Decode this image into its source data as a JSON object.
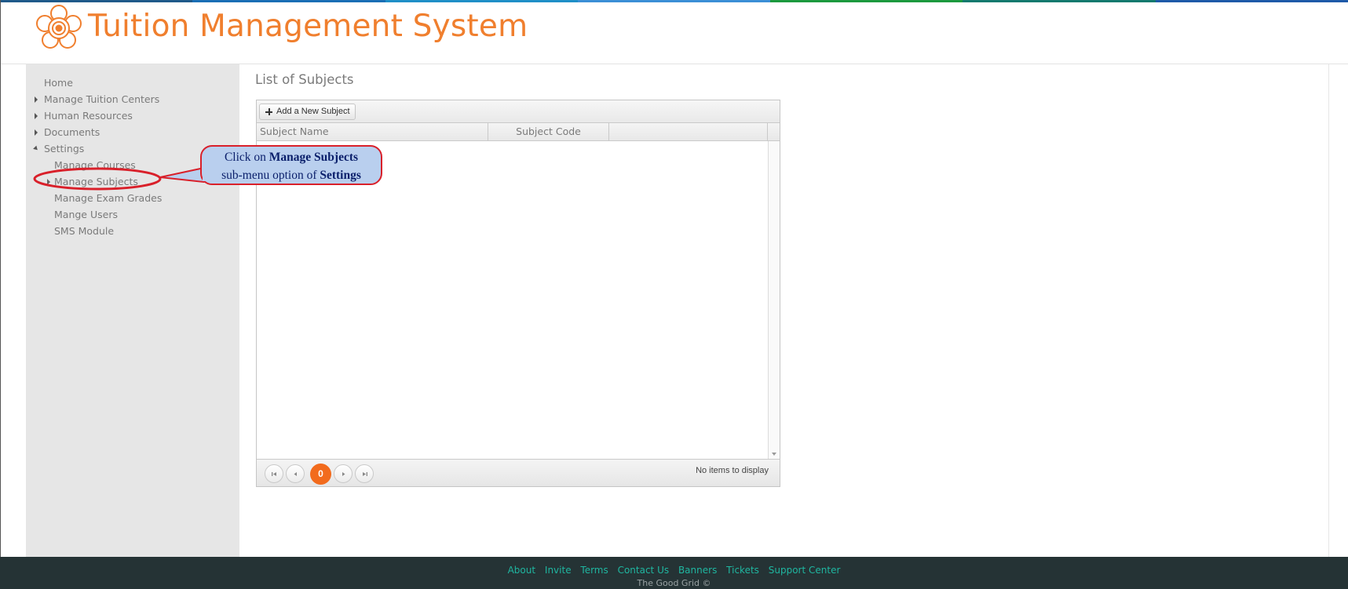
{
  "header": {
    "title": "Tuition Management System",
    "accent_color": "#f07f2e",
    "logo_icon": "flower-logo-icon"
  },
  "topbar_colors": [
    "#1f5a8a",
    "#1a6fb5",
    "#1f8fc7",
    "#3b8fd6",
    "#1c9a3e",
    "#137a6e",
    "#1e5aa8"
  ],
  "sidebar": {
    "items": [
      {
        "label": "Home",
        "level": 1,
        "caret": "none"
      },
      {
        "label": "Manage Tuition Centers",
        "level": 1,
        "caret": "collapsed"
      },
      {
        "label": "Human Resources",
        "level": 1,
        "caret": "collapsed"
      },
      {
        "label": "Documents",
        "level": 1,
        "caret": "collapsed"
      },
      {
        "label": "Settings",
        "level": 1,
        "caret": "expanded"
      },
      {
        "label": "Manage Courses",
        "level": 2,
        "caret": "none"
      },
      {
        "label": "Manage Subjects",
        "level": 2,
        "caret": "collapsed"
      },
      {
        "label": "Manage Exam Grades",
        "level": 2,
        "caret": "none"
      },
      {
        "label": "Mange Users",
        "level": 2,
        "caret": "none"
      },
      {
        "label": "SMS Module",
        "level": 2,
        "caret": "none"
      }
    ]
  },
  "main": {
    "page_title": "List of Subjects",
    "toolbar": {
      "add_label": "Add a New Subject"
    },
    "columns": [
      "Subject Name",
      "Subject Code"
    ],
    "rows": [],
    "pager": {
      "current_page": "0",
      "status": "No items to display"
    }
  },
  "callout": {
    "line1_prefix": "Click on ",
    "line1_bold": "Manage Subjects",
    "line2_prefix": "sub-menu option of ",
    "line2_bold": "Settings",
    "border_color": "#d9202a",
    "fill_color": "#b9cfee"
  },
  "footer": {
    "links": [
      "About",
      "Invite",
      "Terms",
      "Contact Us",
      "Banners",
      "Tickets",
      "Support Center"
    ],
    "copyright": "The Good Grid ©"
  }
}
